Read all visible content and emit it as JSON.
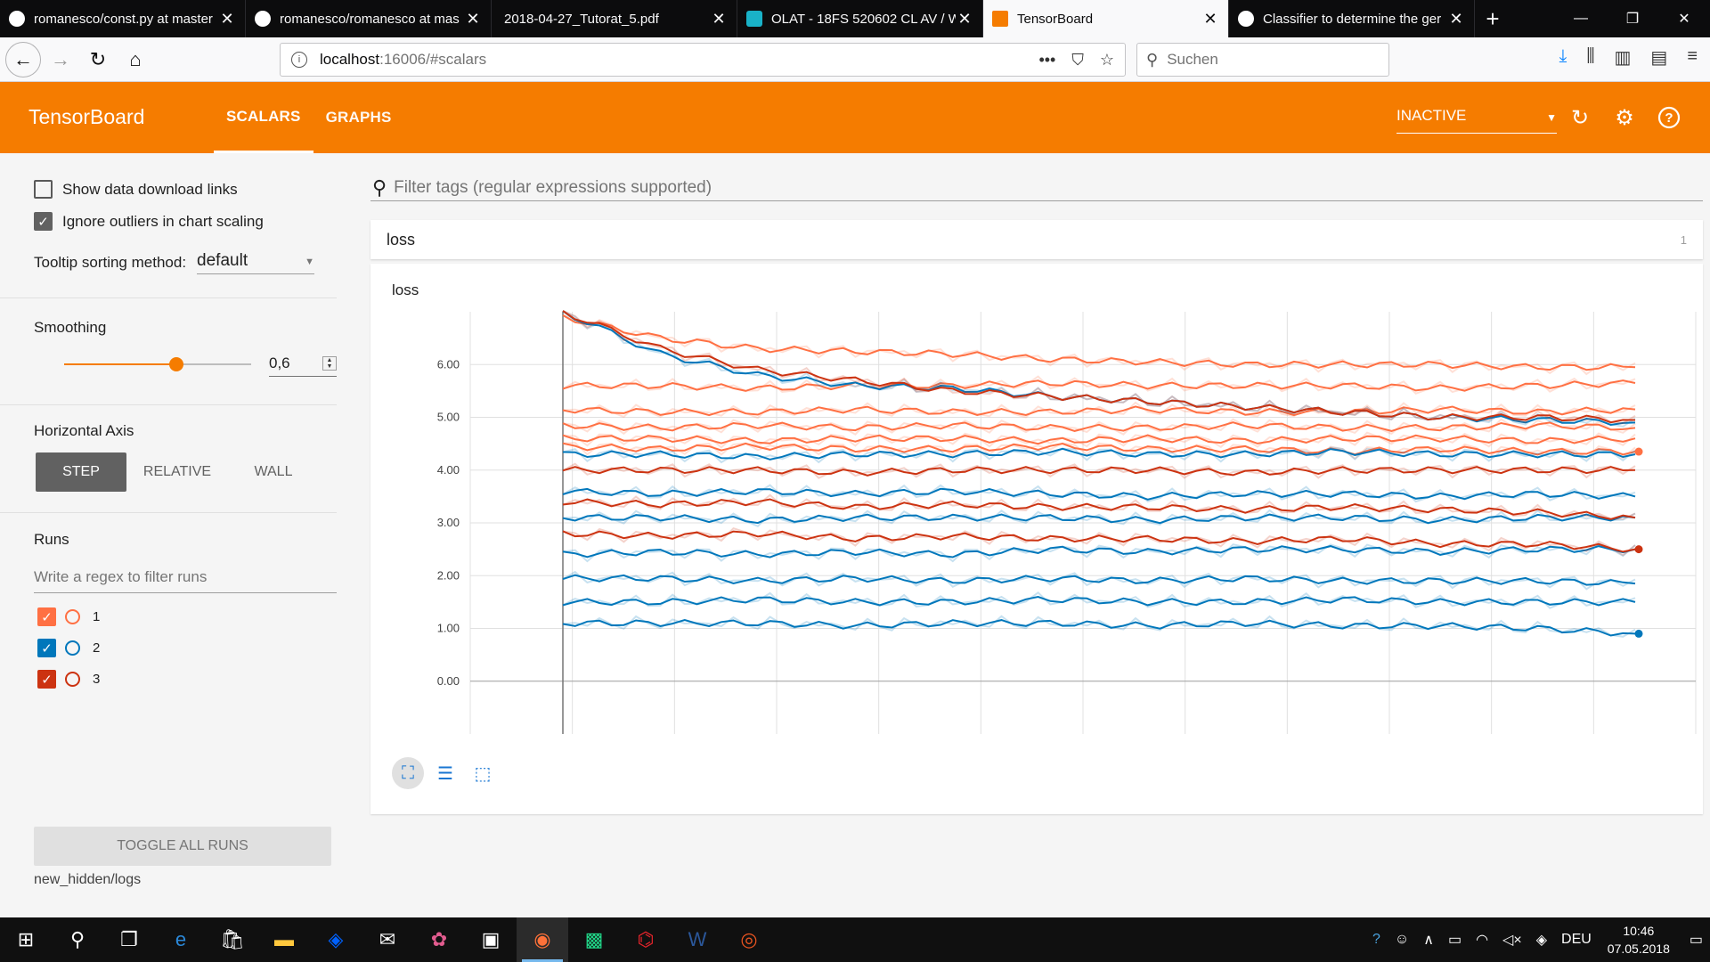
{
  "browser": {
    "tabs": [
      {
        "label": "romanesco/const.py at master",
        "active": false
      },
      {
        "label": "romanesco/romanesco at mas",
        "active": false
      },
      {
        "label": "2018-04-27_Tutorat_5.pdf",
        "active": false
      },
      {
        "label": "OLAT - 18FS 520602 CL AV / W",
        "active": false
      },
      {
        "label": "TensorBoard",
        "active": true
      },
      {
        "label": "Classifier to determine the ger",
        "active": false
      }
    ],
    "new_tab": "+",
    "url_host": "localhost",
    "url_path": ":16006/#scalars",
    "search_placeholder": "Suchen",
    "window_controls": {
      "minimize": "—",
      "restore": "❐",
      "close": "✕"
    }
  },
  "tensorboard": {
    "title": "TensorBoard",
    "tabs": [
      "SCALARS",
      "GRAPHS"
    ],
    "selected_tab": "SCALARS",
    "status": "INACTIVE",
    "accent": "#f57c00"
  },
  "sidebar": {
    "show_download_links": {
      "label": "Show data download links",
      "checked": false
    },
    "ignore_outliers": {
      "label": "Ignore outliers in chart scaling",
      "checked": true
    },
    "tooltip_sorting": {
      "label": "Tooltip sorting method:",
      "value": "default"
    },
    "smoothing": {
      "label": "Smoothing",
      "value": "0,6",
      "fraction": 0.6
    },
    "horizontal_axis": {
      "label": "Horizontal Axis",
      "options": [
        "STEP",
        "RELATIVE",
        "WALL"
      ],
      "selected": "STEP"
    },
    "runs": {
      "label": "Runs",
      "filter_placeholder": "Write a regex to filter runs",
      "items": [
        {
          "name": "1",
          "color": "#ff7043",
          "checked": true
        },
        {
          "name": "2",
          "color": "#0077bb",
          "checked": true
        },
        {
          "name": "3",
          "color": "#cc3311",
          "checked": true
        }
      ]
    },
    "toggle_all": "TOGGLE ALL RUNS",
    "log_dir": "new_hidden/logs"
  },
  "main": {
    "filter_placeholder": "Filter tags (regular expressions supported)",
    "category": {
      "name": "loss",
      "count": "1"
    },
    "chart_title": "loss"
  },
  "chart_data": {
    "type": "line",
    "title": "loss",
    "xlabel": "",
    "ylabel": "",
    "ylim": [
      -1.0,
      7.0
    ],
    "y_ticks": [
      "6.00",
      "5.00",
      "4.00",
      "3.00",
      "2.00",
      "1.00",
      "0.00"
    ],
    "grid": true,
    "series": [
      {
        "run": "1",
        "color": "#ff7043",
        "values": [
          6.9,
          6.5,
          6.3,
          6.25,
          6.2,
          6.1,
          6.05,
          6.0,
          6.0,
          6.0,
          5.95,
          5.95
        ]
      },
      {
        "run": "1",
        "color": "#ff7043",
        "values": [
          5.6,
          5.6,
          5.55,
          5.6,
          5.6,
          5.65,
          5.6,
          5.6,
          5.6,
          5.55,
          5.6,
          5.65
        ]
      },
      {
        "run": "1",
        "color": "#ff7043",
        "values": [
          5.15,
          5.1,
          5.1,
          5.15,
          5.1,
          5.1,
          5.15,
          5.1,
          5.1,
          5.15,
          5.1,
          5.15
        ]
      },
      {
        "run": "1",
        "color": "#ff7043",
        "values": [
          4.85,
          4.8,
          4.85,
          4.8,
          4.85,
          4.8,
          4.8,
          4.85,
          4.8,
          4.8,
          4.85,
          4.8
        ]
      },
      {
        "run": "1",
        "color": "#ff7043",
        "values": [
          4.6,
          4.6,
          4.55,
          4.6,
          4.6,
          4.55,
          4.6,
          4.55,
          4.6,
          4.6,
          4.55,
          4.6
        ]
      },
      {
        "run": "1",
        "color": "#ff7043",
        "values": [
          4.45,
          4.4,
          4.45,
          4.4,
          4.4,
          4.45,
          4.4,
          4.4,
          4.35,
          4.4,
          4.35,
          4.35
        ]
      },
      {
        "run": "2",
        "color": "#0077bb",
        "values": [
          7.0,
          6.2,
          5.8,
          5.6,
          5.55,
          5.4,
          5.3,
          5.2,
          5.1,
          5.0,
          4.95,
          4.9
        ]
      },
      {
        "run": "2",
        "color": "#0077bb",
        "values": [
          4.3,
          4.3,
          4.25,
          4.3,
          4.3,
          4.35,
          4.3,
          4.3,
          4.35,
          4.3,
          4.3,
          4.3
        ]
      },
      {
        "run": "2",
        "color": "#0077bb",
        "values": [
          3.6,
          3.55,
          3.6,
          3.55,
          3.6,
          3.55,
          3.5,
          3.55,
          3.55,
          3.5,
          3.55,
          3.5
        ]
      },
      {
        "run": "2",
        "color": "#0077bb",
        "values": [
          3.1,
          3.1,
          3.05,
          3.1,
          3.1,
          3.1,
          3.05,
          3.1,
          3.1,
          3.05,
          3.1,
          3.1
        ]
      },
      {
        "run": "2",
        "color": "#0077bb",
        "values": [
          2.4,
          2.45,
          2.4,
          2.45,
          2.4,
          2.5,
          2.45,
          2.5,
          2.5,
          2.45,
          2.5,
          2.5
        ]
      },
      {
        "run": "2",
        "color": "#0077bb",
        "values": [
          1.95,
          1.95,
          1.9,
          1.95,
          1.9,
          1.95,
          1.9,
          1.95,
          1.9,
          1.9,
          1.9,
          1.85
        ]
      },
      {
        "run": "2",
        "color": "#0077bb",
        "values": [
          1.5,
          1.5,
          1.55,
          1.5,
          1.5,
          1.55,
          1.5,
          1.5,
          1.55,
          1.5,
          1.5,
          1.5
        ]
      },
      {
        "run": "2",
        "color": "#0077bb",
        "values": [
          1.1,
          1.1,
          1.1,
          1.05,
          1.1,
          1.1,
          1.05,
          1.1,
          1.05,
          1.05,
          1.0,
          0.9
        ]
      },
      {
        "run": "3",
        "color": "#cc3311",
        "values": [
          7.0,
          6.3,
          5.9,
          5.7,
          5.5,
          5.4,
          5.3,
          5.2,
          5.1,
          5.0,
          5.0,
          4.95
        ]
      },
      {
        "run": "3",
        "color": "#cc3311",
        "values": [
          4.0,
          4.0,
          4.0,
          3.95,
          4.0,
          4.0,
          4.0,
          3.95,
          4.0,
          4.0,
          4.0,
          4.0
        ]
      },
      {
        "run": "3",
        "color": "#cc3311",
        "values": [
          3.4,
          3.35,
          3.4,
          3.3,
          3.35,
          3.3,
          3.3,
          3.25,
          3.3,
          3.25,
          3.2,
          3.1
        ]
      },
      {
        "run": "3",
        "color": "#cc3311",
        "values": [
          2.8,
          2.75,
          2.8,
          2.7,
          2.75,
          2.7,
          2.7,
          2.65,
          2.7,
          2.6,
          2.6,
          2.5
        ]
      }
    ]
  },
  "taskbar": {
    "language": "DEU",
    "time": "10:46",
    "date": "07.05.2018"
  }
}
